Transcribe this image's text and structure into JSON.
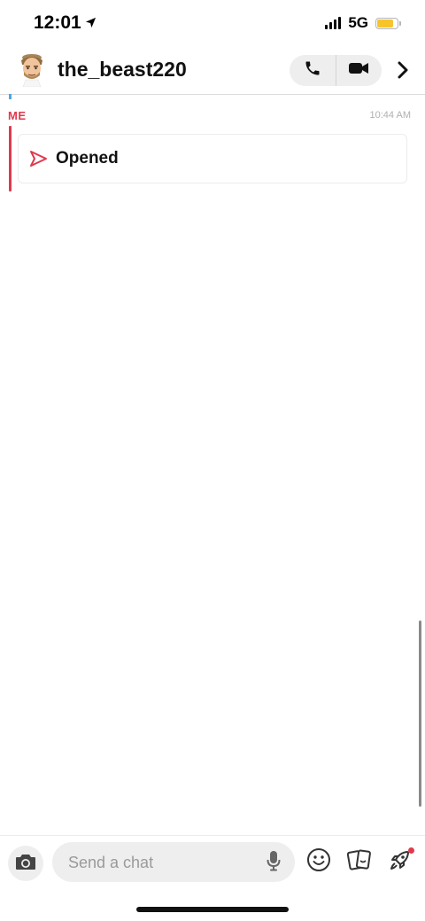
{
  "status_bar": {
    "time": "12:01",
    "network": "5G",
    "battery_level": 0.8,
    "colors": {
      "battery_fill": "#f7c52b"
    },
    "icons": [
      "location-arrow-icon",
      "signal-icon",
      "battery-icon"
    ]
  },
  "header": {
    "title": "the_beast220",
    "icons": [
      "avatar",
      "phone-icon",
      "video-icon",
      "chevron-right-icon"
    ]
  },
  "chat": {
    "messages": [
      {
        "sender": "ME",
        "time": "10:44 AM",
        "status": "Opened",
        "icon": "opened-arrow-icon"
      }
    ],
    "colors": {
      "sender_accent": "#e0394c",
      "other_accent": "#4aa7e8"
    }
  },
  "input_bar": {
    "placeholder": "Send a chat",
    "icons": [
      "camera-icon",
      "mic-icon",
      "emoji-icon",
      "sticker-icon",
      "rocket-icon"
    ],
    "colors": {
      "notification_dot": "#e0394c"
    }
  }
}
